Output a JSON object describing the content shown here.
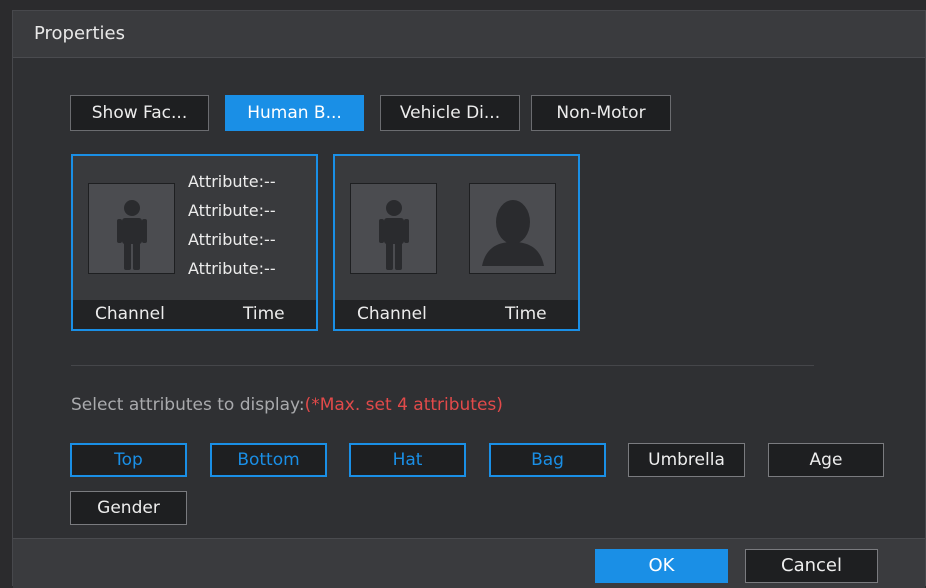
{
  "dialog": {
    "title": "Properties"
  },
  "tabs": [
    {
      "label": "Show Fac...",
      "active": false
    },
    {
      "label": "Human B...",
      "active": true
    },
    {
      "label": "Vehicle Di...",
      "active": false
    },
    {
      "label": "Non-Motor",
      "active": false
    }
  ],
  "preview": {
    "card1": {
      "attributes": [
        "Attribute:--",
        "Attribute:--",
        "Attribute:--",
        "Attribute:--"
      ],
      "channel_label": "Channel",
      "time_label": "Time"
    },
    "card2": {
      "channel_label": "Channel",
      "time_label": "Time"
    }
  },
  "attributes_section": {
    "prompt": "Select attributes to display:",
    "warning": "(*Max. set 4 attributes)",
    "options": [
      {
        "label": "Top",
        "selected": true
      },
      {
        "label": "Bottom",
        "selected": true
      },
      {
        "label": "Hat",
        "selected": true
      },
      {
        "label": "Bag",
        "selected": true
      },
      {
        "label": "Umbrella",
        "selected": false
      },
      {
        "label": "Age",
        "selected": false
      },
      {
        "label": "Gender",
        "selected": false
      }
    ]
  },
  "footer": {
    "ok_label": "OK",
    "cancel_label": "Cancel"
  },
  "colors": {
    "accent": "#1a8fe6",
    "warning": "#e24a4a",
    "background": "#2f3033"
  }
}
